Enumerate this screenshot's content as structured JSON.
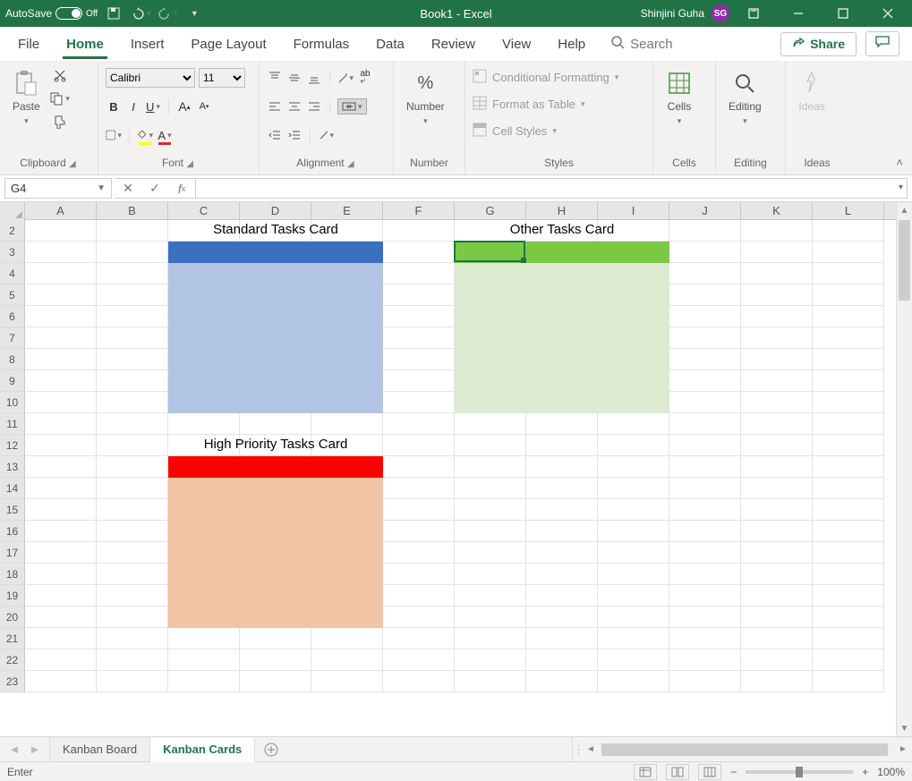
{
  "titlebar": {
    "autosave_label": "AutoSave",
    "autosave_state": "Off",
    "doc_title": "Book1  -  Excel",
    "user_name": "Shinjini Guha",
    "user_initials": "SG"
  },
  "tabs": {
    "items": [
      "File",
      "Home",
      "Insert",
      "Page Layout",
      "Formulas",
      "Data",
      "Review",
      "View",
      "Help"
    ],
    "active": "Home",
    "search_label": "Search",
    "share_label": "Share"
  },
  "ribbon": {
    "clipboard": {
      "label": "Clipboard",
      "paste": "Paste"
    },
    "font": {
      "label": "Font",
      "name": "Calibri",
      "size": "11"
    },
    "alignment": {
      "label": "Alignment"
    },
    "number": {
      "label": "Number",
      "btn": "Number"
    },
    "styles": {
      "label": "Styles",
      "conditional": "Conditional Formatting",
      "table": "Format as Table",
      "cellstyles": "Cell Styles"
    },
    "cells": {
      "label": "Cells",
      "btn": "Cells"
    },
    "editing": {
      "label": "Editing",
      "btn": "Editing"
    },
    "ideas": {
      "label": "Ideas",
      "btn": "Ideas"
    }
  },
  "formula_bar": {
    "name_box": "G4",
    "formula": ""
  },
  "grid": {
    "columns": [
      "A",
      "B",
      "C",
      "D",
      "E",
      "F",
      "G",
      "H",
      "I",
      "J",
      "K",
      "L"
    ],
    "first_row": 2,
    "last_row": 23,
    "active_cell": "G4",
    "cards": {
      "standard": {
        "title": "Standard Tasks Card",
        "header_color": "#3b6fbf",
        "body_color": "#b1c4e3",
        "title_cell": "D3",
        "range_cols": "C:E",
        "header_row": 4,
        "body_rows": "5:11"
      },
      "other": {
        "title": "Other Tasks Card",
        "header_color": "#7ac943",
        "body_color": "#dcebcf",
        "title_cell": "H3",
        "range_cols": "G:I",
        "header_row": 4,
        "body_rows": "5:11"
      },
      "high": {
        "title": "High Priority Tasks Card",
        "header_color": "#ff0000",
        "body_color": "#f2c3a5",
        "title_cell": "D13",
        "range_cols": "C:E",
        "header_row": 14,
        "body_rows": "15:21"
      }
    }
  },
  "sheet_tabs": {
    "tabs": [
      {
        "name": "Kanban Board",
        "active": false
      },
      {
        "name": "Kanban Cards",
        "active": true
      }
    ]
  },
  "status_bar": {
    "mode": "Enter",
    "zoom": "100%"
  }
}
